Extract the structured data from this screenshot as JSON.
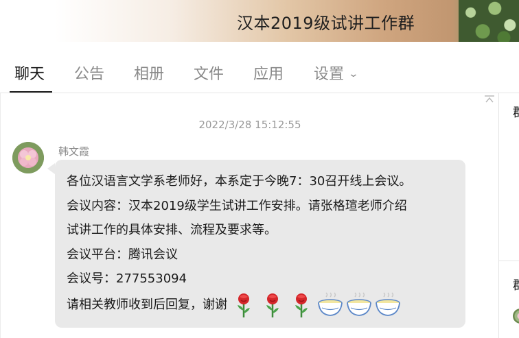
{
  "window": {
    "title": "汉本2019级试讲工作群"
  },
  "tabs": [
    {
      "label": "聊天",
      "active": true
    },
    {
      "label": "公告",
      "active": false
    },
    {
      "label": "相册",
      "active": false
    },
    {
      "label": "文件",
      "active": false
    },
    {
      "label": "应用",
      "active": false
    },
    {
      "label": "设置",
      "active": false,
      "icon": "chevron-down-icon"
    }
  ],
  "chat": {
    "timestamp": "2022/3/28 15:12:55",
    "message": {
      "sender": "韩文霞",
      "lines": [
        "各位汉语言文学系老师好，本系定于今晚7：30召开线上会议。",
        "会议内容：汉本2019级学生试讲工作安排。请张格瑄老师介绍",
        "试讲工作的具体安排、流程及要求等。",
        "会议平台：腾讯会议",
        "会议号：277553094",
        "请相关教师收到后回复，谢谢"
      ],
      "emojis": [
        "rose-emoji",
        "rose-emoji",
        "rose-emoji",
        "tea-bowl-emoji",
        "tea-bowl-emoji",
        "tea-bowl-emoji"
      ]
    }
  },
  "side_panel": {
    "heading_1": "群",
    "heading_2": "群"
  },
  "colors": {
    "bubble": "#e9e9e9",
    "active_tab": "#1a1a1a",
    "inactive_tab": "#8a8a8a"
  }
}
